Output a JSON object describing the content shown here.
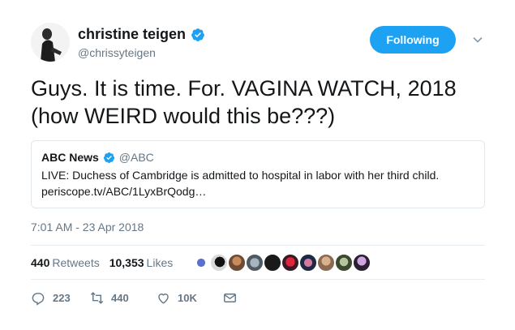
{
  "tweet": {
    "author": {
      "display_name": "christine teigen",
      "handle": "@chrissyteigen",
      "verified_icon": "verified-badge-icon"
    },
    "follow_button": {
      "label": "Following"
    },
    "text": "Guys. It is time. For. VAGINA WATCH, 2018 (how WEIRD would this be???)",
    "quoted": {
      "name": "ABC News",
      "handle": "@ABC",
      "text": "LIVE: Duchess of Cambridge is admitted to hospital in labor with her third child.",
      "link": "periscope.tv/ABC/1LyxBrQodg…"
    },
    "timestamp": "7:01 AM - 23 Apr 2018",
    "stats": {
      "retweets_count": "440",
      "retweets_label": "Retweets",
      "likes_count": "10,353",
      "likes_label": "Likes"
    },
    "actions": {
      "reply_count": "223",
      "retweet_count": "440",
      "like_count": "10K"
    }
  },
  "colors": {
    "accent": "#1da1f2",
    "muted": "#657786",
    "text": "#14171a",
    "border": "#e1e8ed"
  }
}
